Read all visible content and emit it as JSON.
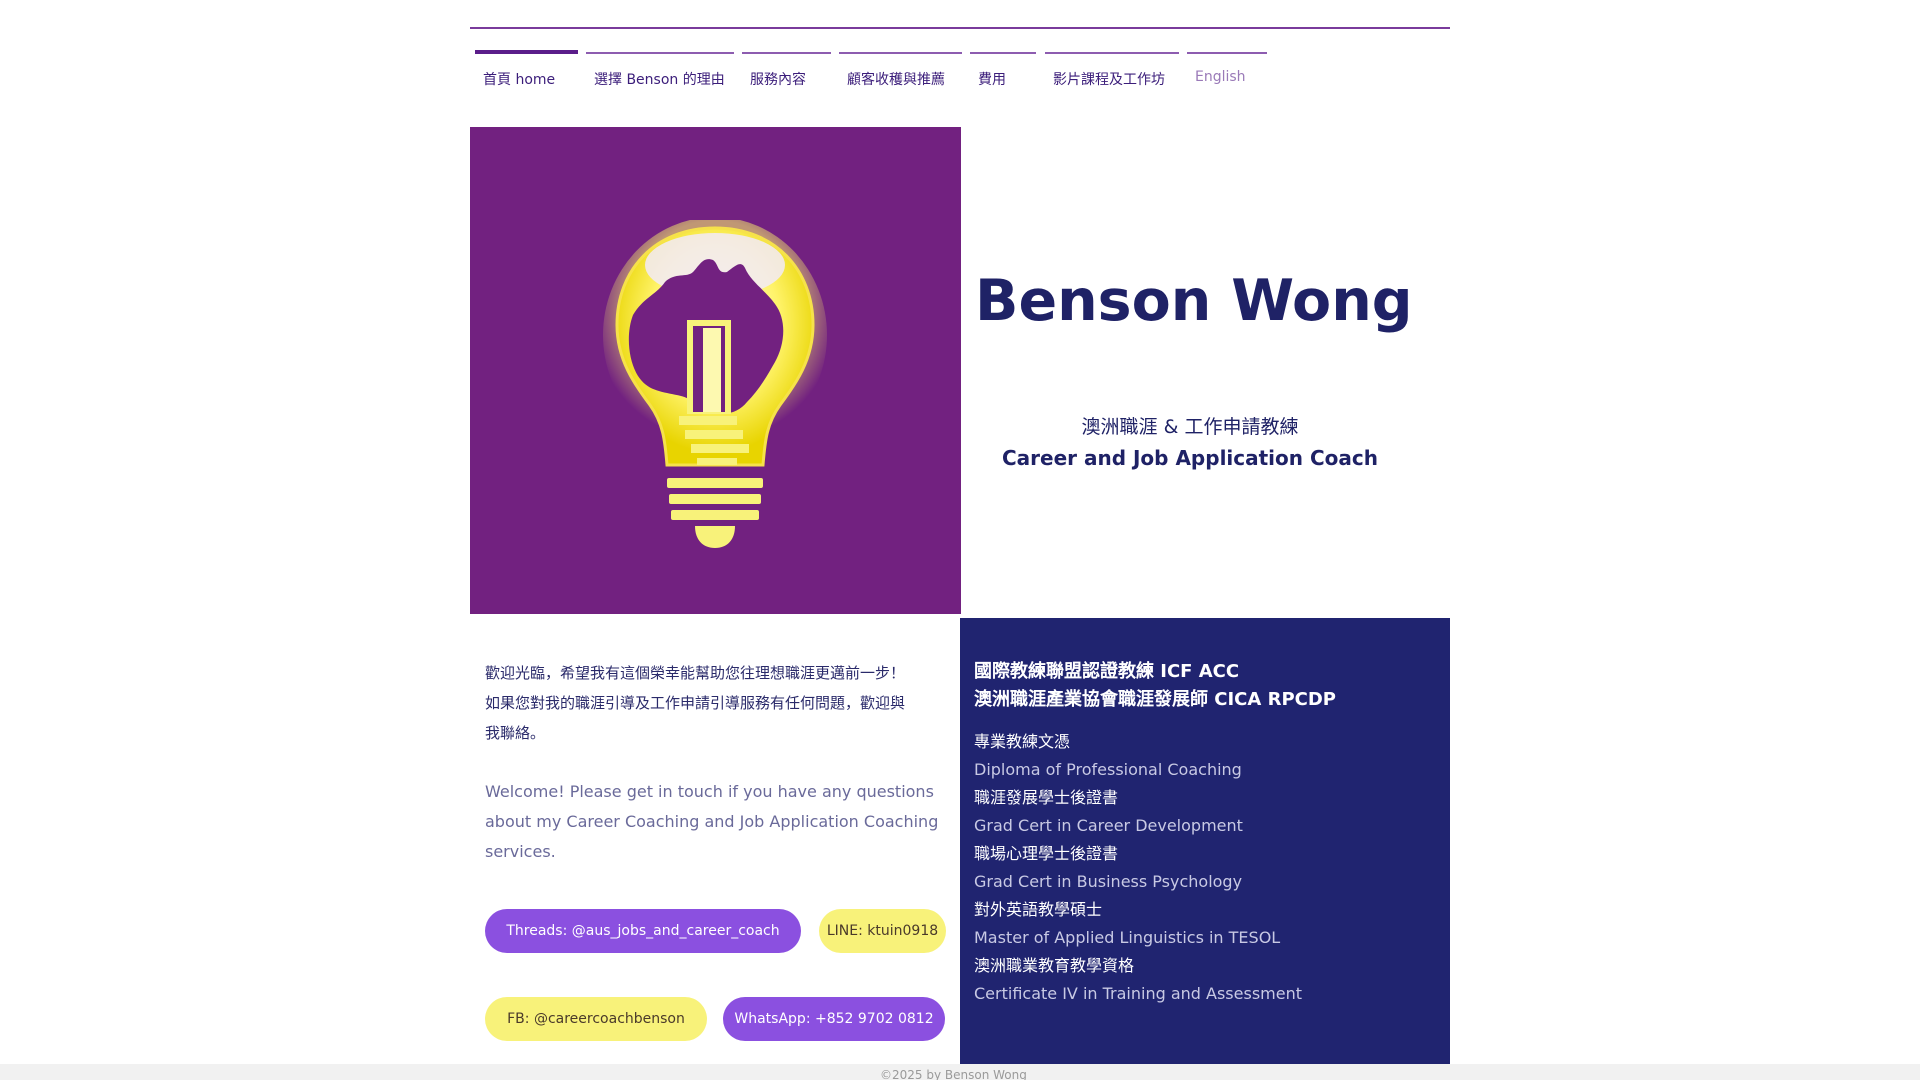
{
  "nav": {
    "items": [
      {
        "label": "首頁 home"
      },
      {
        "label": "選擇 Benson 的理由"
      },
      {
        "label": "服務內容"
      },
      {
        "label": "顧客收穫與推薦"
      },
      {
        "label": "費用"
      },
      {
        "label": "影片課程及工作坊"
      },
      {
        "label": "English"
      }
    ]
  },
  "hero": {
    "name": "Benson Wong",
    "subtitle_cn": "澳洲職涯 & 工作申請教練",
    "subtitle_en": "Career and Job Application Coach"
  },
  "welcome": {
    "cn_lines": [
      "歡迎光臨，希望我有這個榮幸能幫助您往理想職涯更邁前一步！",
      "如果您對我的職涯引導及工作申請引導服務有任何問題，歡迎與",
      "我聯絡。"
    ],
    "en_lines": [
      "Welcome! Please get in touch if you have any questions",
      "about my Career Coaching and Job Application Coaching",
      "services."
    ]
  },
  "contacts": {
    "threads": "Threads: @aus_jobs_and_career_coach",
    "line": "LINE: ktuin0918",
    "fb": "FB: @careercoachbenson",
    "whatsapp": "WhatsApp: +852 9702 0812"
  },
  "credentials": {
    "heading_1": "國際教練聯盟認證教練 ICF ACC",
    "heading_2": "澳洲職涯產業協會職涯發展師 CICA RPCDP",
    "items": [
      {
        "cn": "專業教練文憑",
        "en": "Diploma of Professional Coaching"
      },
      {
        "cn": "職涯發展學士後證書",
        "en": "Grad Cert in Career Development"
      },
      {
        "cn": "職場心理學士後證書",
        "en": "Grad Cert in Business Psychology"
      },
      {
        "cn": "對外英語教學碩士",
        "en": "Master of Applied Linguistics in TESOL"
      },
      {
        "cn": "澳洲職業教育教學資格",
        "en": "Certificate IV in Training and Assessment"
      }
    ]
  },
  "footer": {
    "text": "©2025 by Benson Wong"
  },
  "colors": {
    "brand_purple": "#722180",
    "navy": "#202470",
    "pill_purple": "#8b50e0",
    "pill_yellow": "#f8f27a"
  },
  "icons": {
    "logo": "lightbulb-australia-door-icon"
  }
}
